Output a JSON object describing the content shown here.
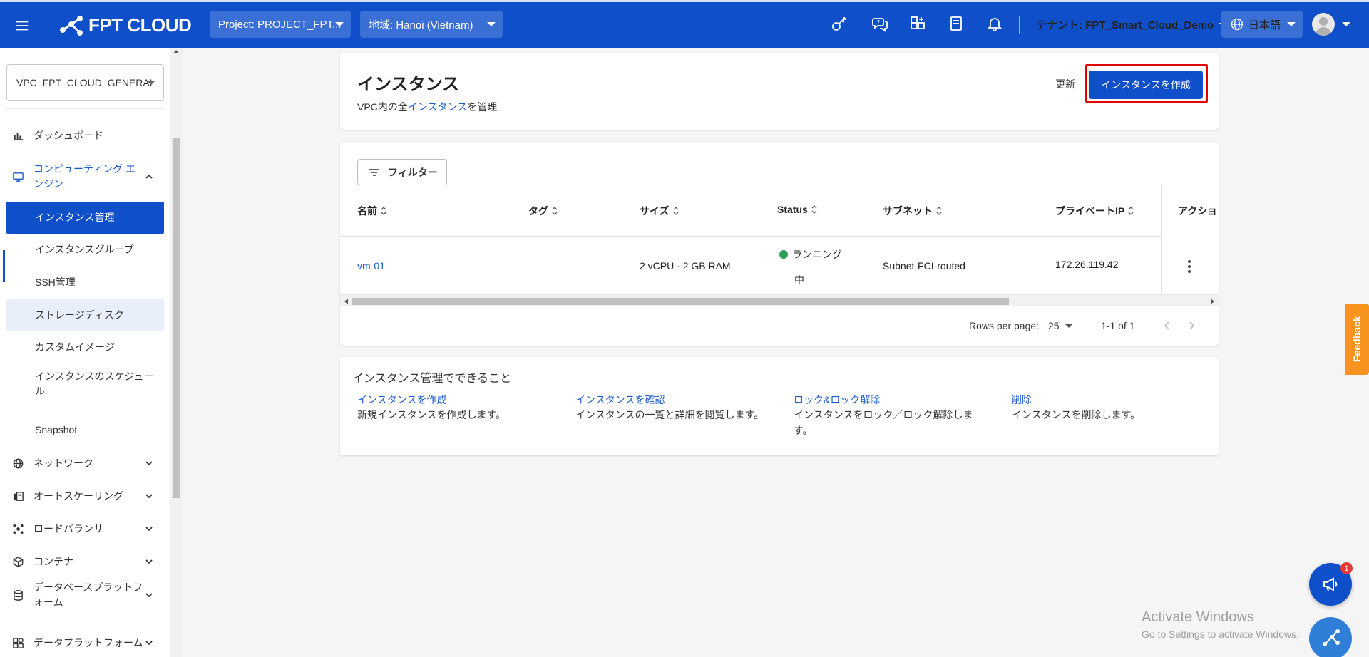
{
  "topbar": {
    "logo_text": "FPT CLOUD",
    "project": "Project: PROJECT_FPT...",
    "region": "地域: Hanoi (Vietnam)",
    "icons": [
      "key-icon",
      "support-icon",
      "apps-icon",
      "billing-icon",
      "bell-icon"
    ],
    "tenant": "テナント: FPT_Smart_Cloud_Demo",
    "language": "日本語",
    "brand_color": "#0f4fc9"
  },
  "sidebar": {
    "vpc": "VPC_FPT_CLOUD_GENERAL",
    "items": [
      {
        "label": "ダッシュボード",
        "icon": "bar-chart-icon"
      },
      {
        "label": "コンピューティング エンジン",
        "icon": "monitor-icon",
        "expanded": true
      },
      {
        "label": "ネットワーク",
        "icon": "globe-icon"
      },
      {
        "label": "オートスケーリング",
        "icon": "autoscale-icon"
      },
      {
        "label": "ロードバランサ",
        "icon": "load-balancer-icon"
      },
      {
        "label": "コンテナ",
        "icon": "container-icon"
      },
      {
        "label": "データベースプラットフォーム",
        "icon": "database-icon"
      },
      {
        "label": "データプラットフォーム",
        "icon": "data-platform-icon"
      }
    ],
    "sub_items": [
      {
        "label": "インスタンス管理",
        "selected": true
      },
      {
        "label": "インスタンスグループ"
      },
      {
        "label": "SSH管理"
      },
      {
        "label": "ストレージディスク"
      },
      {
        "label": "カスタムイメージ"
      },
      {
        "label": "インスタンスのスケジュール"
      },
      {
        "label": "Snapshot"
      }
    ]
  },
  "header": {
    "title": "インスタンス",
    "subtitle_prefix": "VPC内の全",
    "subtitle_link": "インスタンス",
    "subtitle_suffix": "を管理",
    "refresh": "更新",
    "create": "インスタンスを作成"
  },
  "table": {
    "filter": "フィルター",
    "columns": [
      "名前",
      "タグ",
      "サイズ",
      "Status",
      "サブネット",
      "プライベートIP",
      "アクショ"
    ],
    "rows": [
      {
        "name": "vm-01",
        "tag": "",
        "size": "2 vCPU · 2 GB RAM",
        "status_line1": "ランニング",
        "status_line2": "中",
        "subnet": "Subnet-FCI-routed",
        "ip": "172.26.119.42"
      }
    ],
    "rows_per_page_label": "Rows per page:",
    "rows_per_page": "25",
    "range": "1-1 of 1"
  },
  "info": {
    "title": "インスタンス管理でできること",
    "items": [
      {
        "title": "インスタンスを作成",
        "desc": "新規インスタンスを作成します。"
      },
      {
        "title": "インスタンスを確認",
        "desc": "インスタンスの一覧と詳細を閲覧します。"
      },
      {
        "title": "ロック&ロック解除",
        "desc": "インスタンスをロック／ロック解除します。"
      },
      {
        "title": "削除",
        "desc": "インスタンスを削除します。"
      }
    ]
  },
  "floating": {
    "feedback": "Feedback",
    "badge": "1"
  },
  "watermark": {
    "line1": "Activate Windows",
    "line2": "Go to Settings to activate Windows."
  }
}
